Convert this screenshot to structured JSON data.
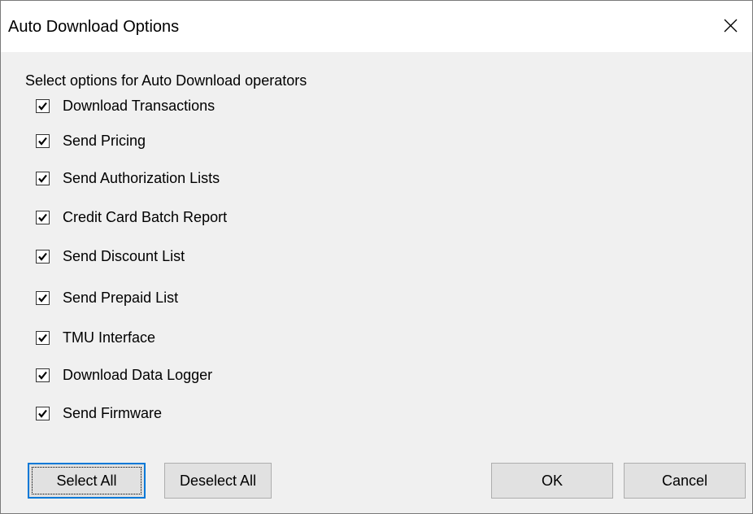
{
  "dialog": {
    "title": "Auto Download Options",
    "close_icon": "close-icon"
  },
  "options": {
    "group_label": "Select options for Auto Download operators",
    "items": [
      {
        "label": "Download Transactions",
        "checked": true
      },
      {
        "label": "Send Pricing",
        "checked": true
      },
      {
        "label": "Send Authorization Lists",
        "checked": true
      },
      {
        "label": "Credit Card Batch Report",
        "checked": true
      },
      {
        "label": "Send Discount List",
        "checked": true
      },
      {
        "label": "Send Prepaid List",
        "checked": true
      },
      {
        "label": "TMU Interface",
        "checked": true
      },
      {
        "label": "Download Data Logger",
        "checked": true
      },
      {
        "label": "Send Firmware",
        "checked": true
      }
    ]
  },
  "buttons": {
    "select_all": "Select All",
    "deselect_all": "Deselect All",
    "ok": "OK",
    "cancel": "Cancel"
  },
  "colors": {
    "window_bg": "#f0f0f0",
    "titlebar_bg": "#ffffff",
    "button_bg": "#e1e1e1",
    "focus_accent": "#0078d7"
  }
}
